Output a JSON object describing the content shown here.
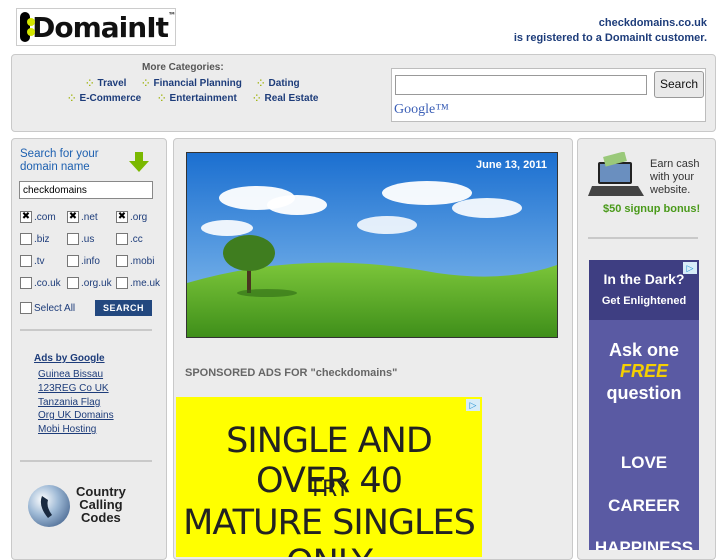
{
  "logo": {
    "text": "DomainIt",
    "tm": "™"
  },
  "registration": {
    "domain": "checkdomains.co.uk",
    "notice": "is registered to a DomainIt customer."
  },
  "categories": {
    "heading": "More Categories:",
    "row1": [
      "Travel",
      "Financial Planning",
      "Dating"
    ],
    "row2": [
      "E-Commerce",
      "Entertainment",
      "Real Estate"
    ]
  },
  "search": {
    "button": "Search",
    "value": "",
    "google_label": "Google™"
  },
  "domain_search": {
    "title": "Search for your domain name",
    "value": "checkdomains",
    "tlds": [
      {
        "label": ".com",
        "checked": true
      },
      {
        "label": ".net",
        "checked": true
      },
      {
        "label": ".org",
        "checked": true
      },
      {
        "label": ".biz",
        "checked": false
      },
      {
        "label": ".us",
        "checked": false
      },
      {
        "label": ".cc",
        "checked": false
      },
      {
        "label": ".tv",
        "checked": false
      },
      {
        "label": ".info",
        "checked": false
      },
      {
        "label": ".mobi",
        "checked": false
      },
      {
        "label": ".co.uk",
        "checked": false
      },
      {
        "label": ".org.uk",
        "checked": false
      },
      {
        "label": ".me.uk",
        "checked": false
      }
    ],
    "select_all": "Select All",
    "button": "SEARCH"
  },
  "ads_by_google": {
    "title": "Ads by Google",
    "links": [
      "Guinea Bissau",
      "123REG Co UK",
      "Tanzania Flag",
      "Org UK Domains",
      "Mobi Hosting"
    ]
  },
  "calling_codes": {
    "line1": "Country",
    "line2": "Calling",
    "line3": "Codes"
  },
  "hero": {
    "date": "June 13, 2011"
  },
  "sponsored": {
    "label": "SPONSORED ADS FOR \"checkdomains\""
  },
  "big_ad": {
    "line1": "SINGLE AND OVER 40",
    "line2": "TRY",
    "line3": "MATURE SINGLES ONLY"
  },
  "earn_ad": {
    "line1": "Earn cash",
    "line2": "with your",
    "line3": "website.",
    "bonus": "$50 signup bonus!"
  },
  "dark_ad": {
    "title": "In the Dark?",
    "subtitle": "Get Enlightened",
    "ask1": "Ask one",
    "ask2": "FREE",
    "ask3": "question",
    "topic1": "LOVE",
    "topic2": "CAREER",
    "topic3": "HAPPINESS"
  },
  "colors": {
    "link": "#1d3c7a",
    "accent_green": "#9bb000",
    "button_blue": "#23487f",
    "ad_yellow": "#ffff00",
    "ad_purple": "#5a5aa3"
  }
}
